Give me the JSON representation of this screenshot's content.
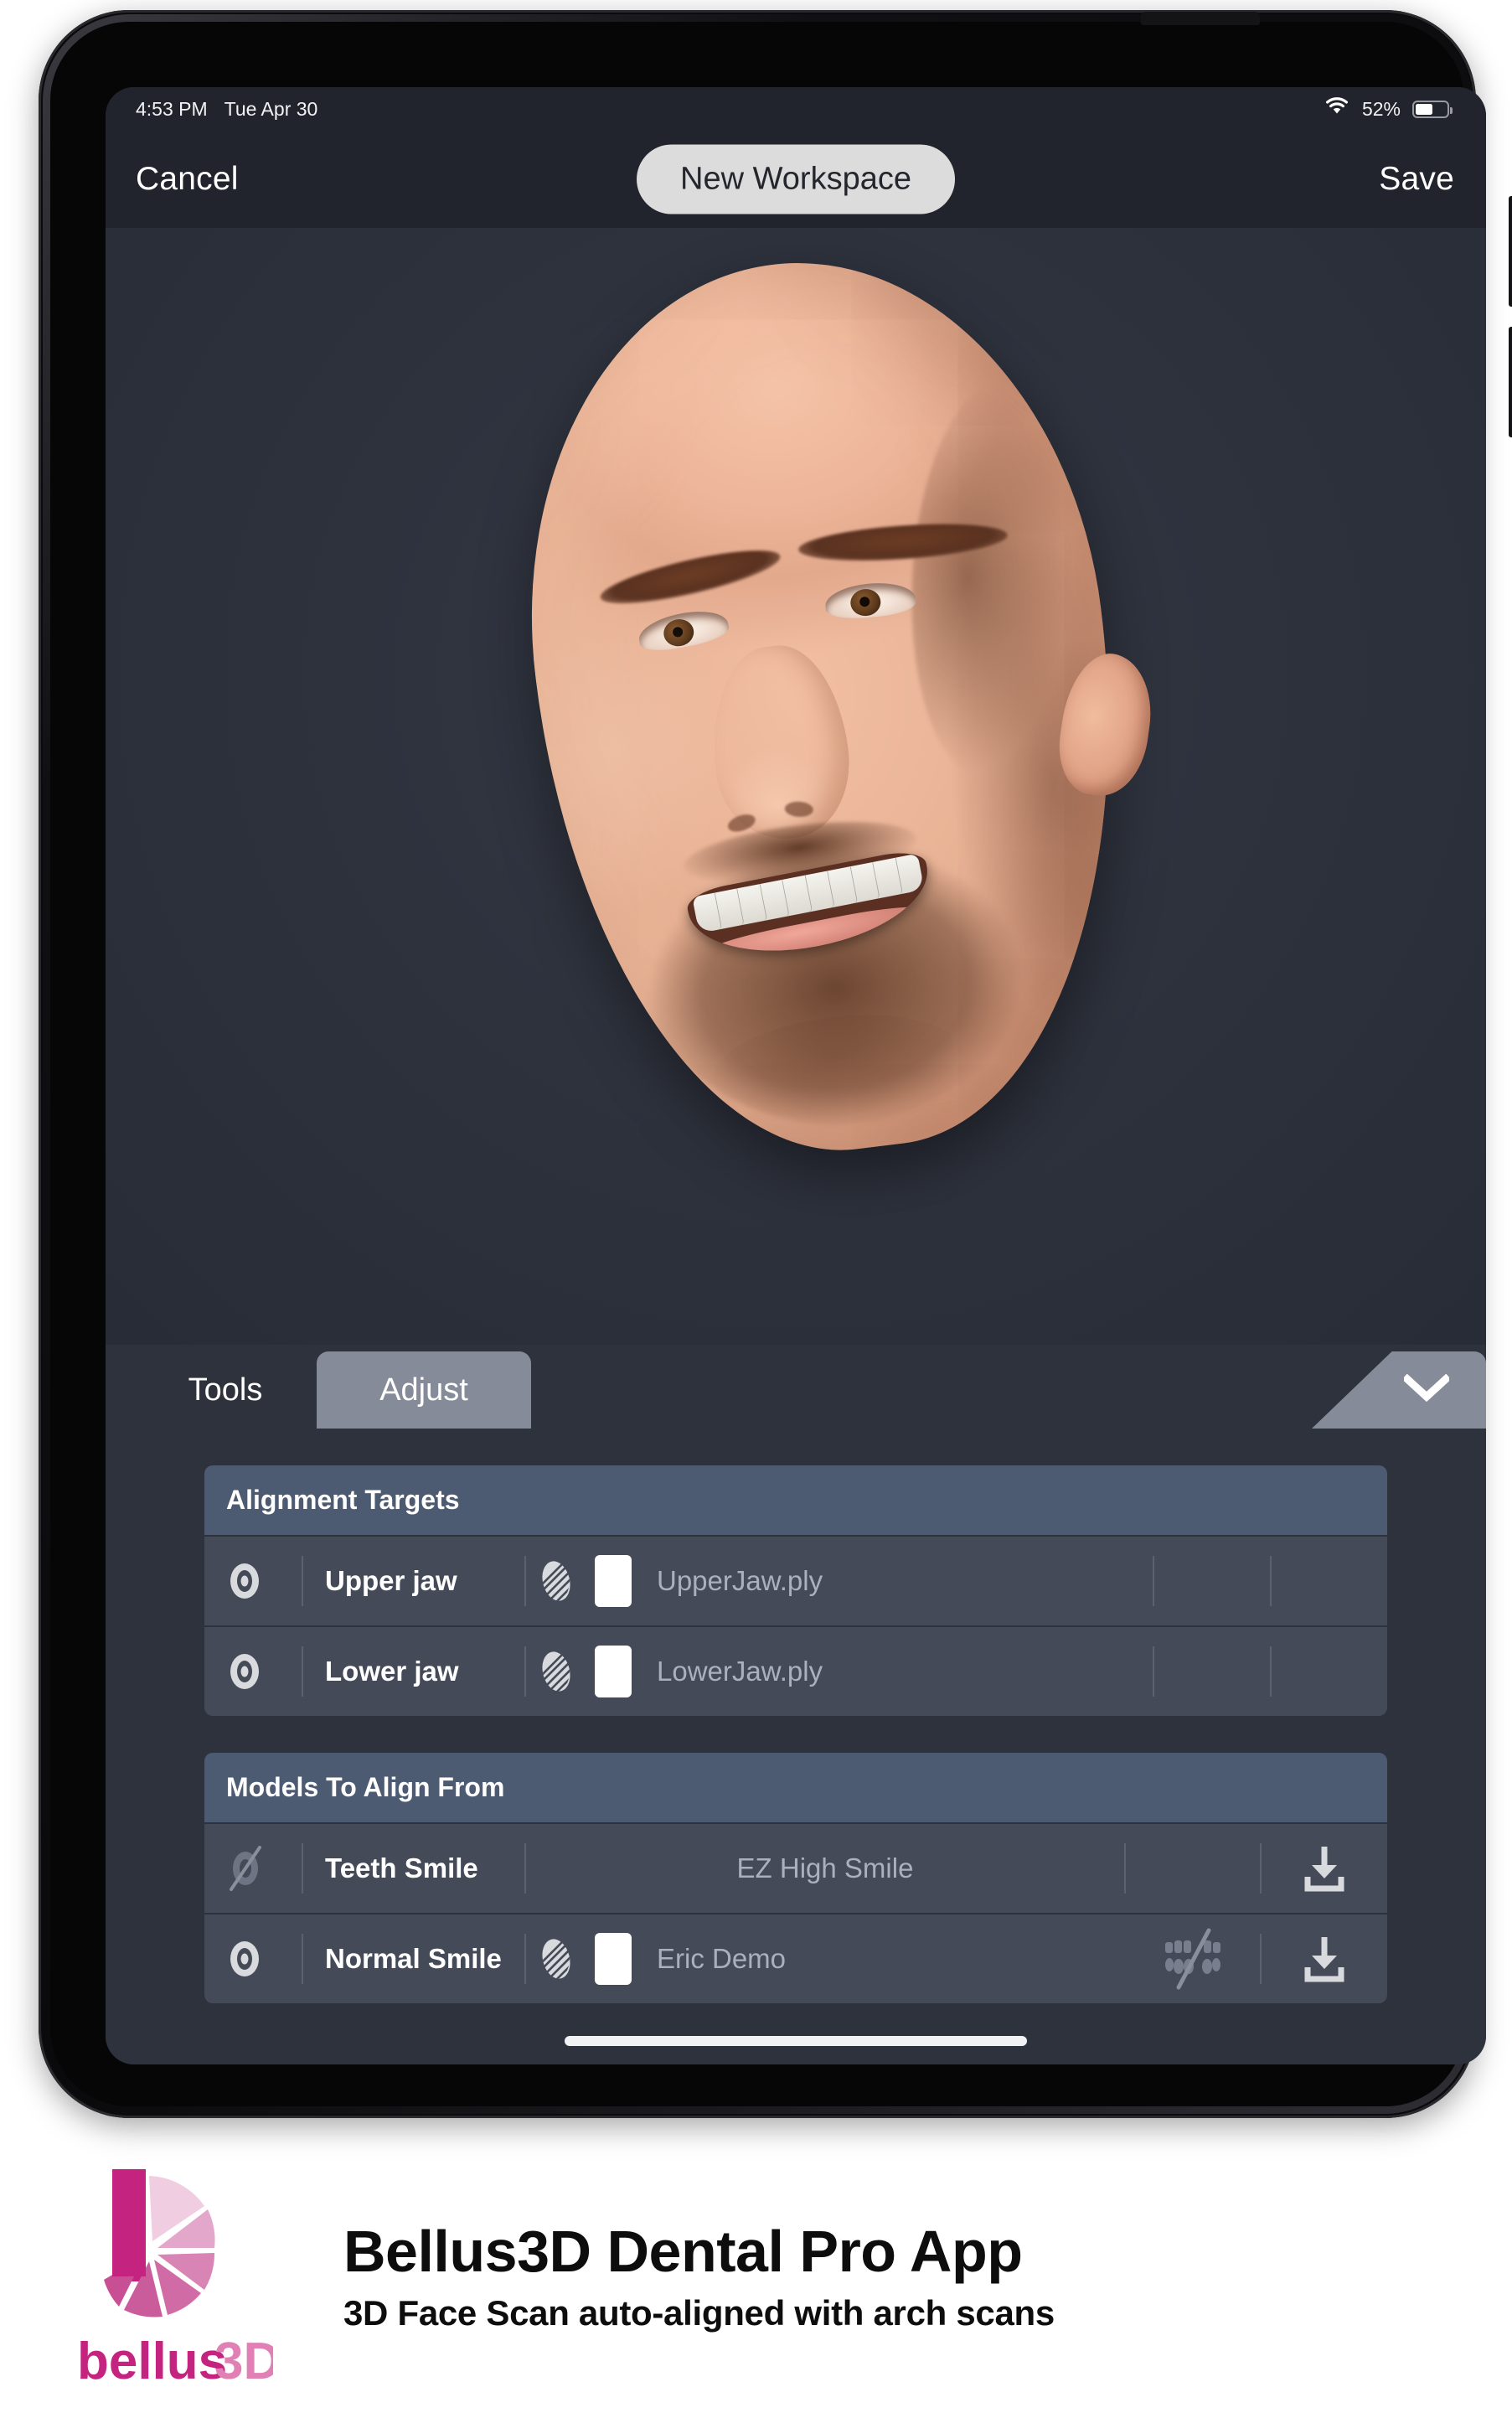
{
  "status_bar": {
    "time": "4:53 PM",
    "date": "Tue Apr 30",
    "battery_percent": "52%",
    "battery_level": 52,
    "wifi_icon": "wifi-icon"
  },
  "nav": {
    "cancel_label": "Cancel",
    "title": "New Workspace",
    "save_label": "Save"
  },
  "tabs": {
    "tools_label": "Tools",
    "adjust_label": "Adjust",
    "active": "Adjust",
    "collapse_icon": "chevron-down-icon"
  },
  "viewport": {
    "content": "3D face scan model",
    "background_color": "#2e323d"
  },
  "groups": [
    {
      "title": "Alignment Targets",
      "rows": [
        {
          "visibility_icon": "eye-icon",
          "visible": true,
          "name": "Upper jaw",
          "scan_icon": "mesh-scan-icon",
          "swatch_color": "#ffffff",
          "file": "UpperJaw.ply",
          "teeth_icon": "",
          "download_icon": ""
        },
        {
          "visibility_icon": "eye-icon",
          "visible": true,
          "name": "Lower jaw",
          "scan_icon": "mesh-scan-icon",
          "swatch_color": "#ffffff",
          "file": "LowerJaw.ply",
          "teeth_icon": "",
          "download_icon": ""
        }
      ]
    },
    {
      "title": "Models To Align From",
      "rows": [
        {
          "visibility_icon": "eye-slash-icon",
          "visible": false,
          "name": "Teeth Smile",
          "scan_icon": "",
          "swatch_color": "",
          "file": "EZ High Smile",
          "teeth_icon": "",
          "download_icon": "download-icon"
        },
        {
          "visibility_icon": "eye-icon",
          "visible": true,
          "name": "Normal Smile",
          "scan_icon": "mesh-scan-icon",
          "swatch_color": "#ffffff",
          "file": "Eric Demo",
          "teeth_icon": "teeth-slash-icon",
          "download_icon": "download-icon"
        }
      ]
    }
  ],
  "branding": {
    "title": "Bellus3D Dental Pro App",
    "subtitle": "3D Face Scan auto-aligned with arch scans",
    "logo_name": "bellus3d-logo",
    "logo_wordmark": "bellus3D",
    "accent_color": "#c4247f",
    "accent_light": "#e6a8cc"
  },
  "colors": {
    "panel_bg": "#2e323d",
    "row_bg": "#444a58",
    "group_header_bg": "#4c5a72",
    "nav_bg": "#21242c",
    "tab_active_bg": "#868b99"
  }
}
